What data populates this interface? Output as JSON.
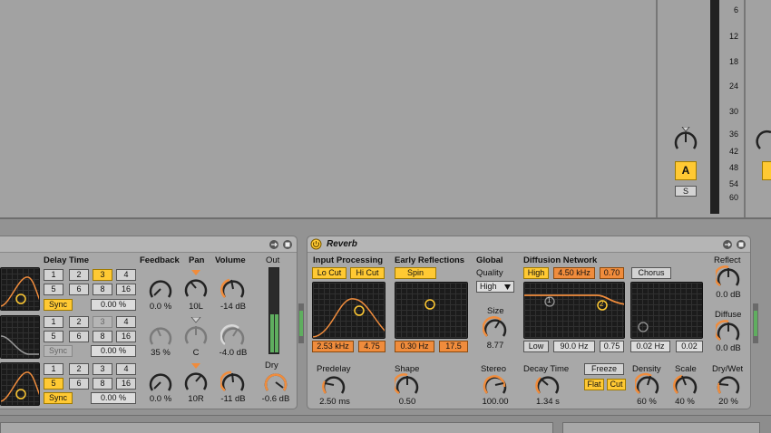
{
  "mixer": {
    "ticks": [
      "6",
      "12",
      "18",
      "24",
      "30",
      "36",
      "42",
      "48",
      "54",
      "60"
    ],
    "track_a_label": "A",
    "solo_label": "S"
  },
  "delay": {
    "delay_time_title": "Delay Time",
    "feedback_title": "Feedback",
    "pan_title": "Pan",
    "volume_title": "Volume",
    "out_title": "Out",
    "dry_title": "Dry",
    "rows": [
      {
        "buttons": [
          "1",
          "2",
          "3",
          "4",
          "5",
          "6",
          "8",
          "16"
        ],
        "active": "3",
        "sync": "Sync",
        "percent": "0.00 %",
        "feedback": "0.0 %",
        "pan": "10L",
        "volume": "-14 dB"
      },
      {
        "buttons": [
          "1",
          "2",
          "3",
          "4",
          "5",
          "6",
          "8",
          "16"
        ],
        "active": "3",
        "sync": "Sync",
        "percent": "0.00 %",
        "feedback": "35 %",
        "pan": "C",
        "volume": "-4.0 dB"
      },
      {
        "buttons": [
          "1",
          "2",
          "3",
          "4",
          "5",
          "6",
          "8",
          "16"
        ],
        "active": "5",
        "sync": "Sync",
        "percent": "0.00 %",
        "feedback": "0.0 %",
        "pan": "10R",
        "volume": "-11 dB"
      }
    ],
    "dry_value": "-0.6 dB"
  },
  "reverb": {
    "title": "Reverb",
    "input_processing": "Input Processing",
    "lo_cut": "Lo Cut",
    "hi_cut": "Hi Cut",
    "freq1": "2.53 kHz",
    "q1": "4.75",
    "early_reflections": "Early Reflections",
    "spin": "Spin",
    "er_freq": "0.30 Hz",
    "er_amt": "17.5",
    "global": "Global",
    "quality_label": "Quality",
    "quality_value": "High",
    "size_label": "Size",
    "size_value": "8.77",
    "diffusion_network": "Diffusion Network",
    "high_btn": "High",
    "high_freq": "4.50 kHz",
    "high_amt": "0.70",
    "chorus": "Chorus",
    "low_btn": "Low",
    "low_freq": "90.0 Hz",
    "low_amt": "0.75",
    "chorus_freq": "0.02 Hz",
    "chorus_amt": "0.02",
    "reflect_label": "Reflect",
    "reflect_value": "0.0 dB",
    "diffuse_label": "Diffuse",
    "diffuse_value": "0.0 dB",
    "predelay_label": "Predelay",
    "predelay_value": "2.50 ms",
    "shape_label": "Shape",
    "shape_value": "0.50",
    "stereo_label": "Stereo",
    "stereo_value": "100.00",
    "decay_label": "Decay Time",
    "decay_value": "1.34 s",
    "freeze": "Freeze",
    "flat": "Flat",
    "cut": "Cut",
    "density_label": "Density",
    "density_value": "60 %",
    "scale_label": "Scale",
    "scale_value": "40 %",
    "drywet_label": "Dry/Wet",
    "drywet_value": "20 %",
    "node1": "1",
    "node2": "2"
  },
  "colors": {
    "accent": "#ffc933",
    "orange": "#f08c3c",
    "panel": "#a8a8a8"
  }
}
